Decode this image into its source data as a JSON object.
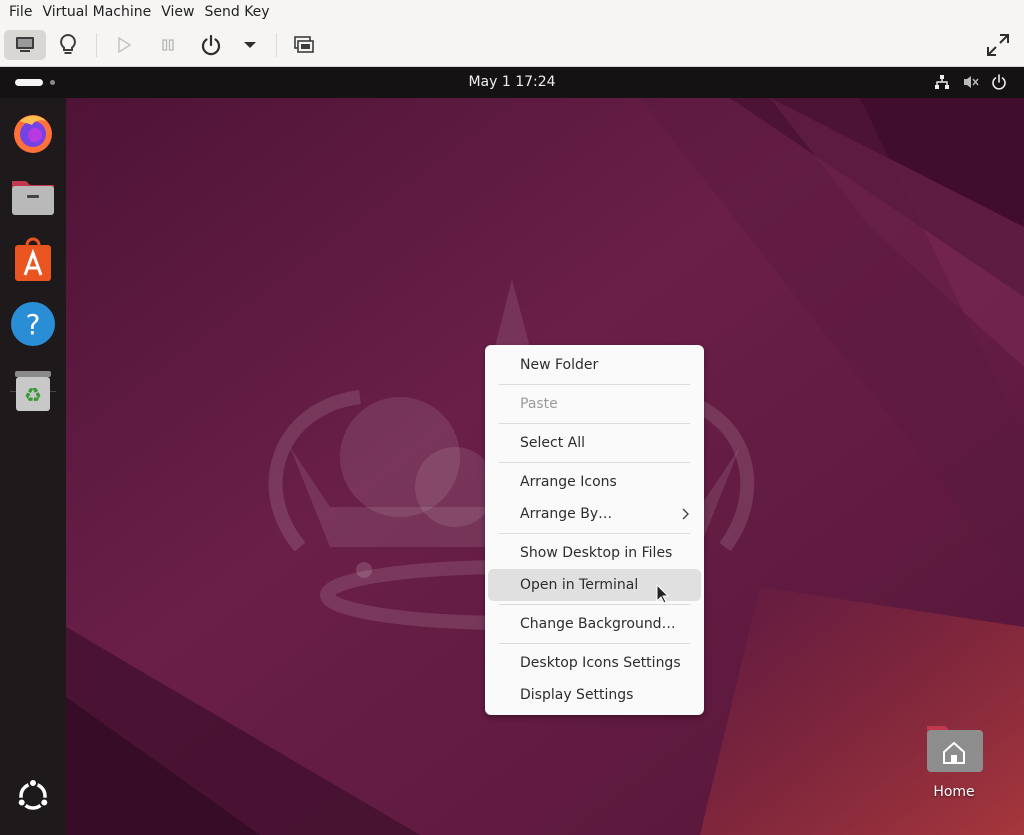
{
  "menubar": {
    "items": [
      "File",
      "Virtual Machine",
      "View",
      "Send Key"
    ]
  },
  "toolbar": {
    "buttons": [
      "display-icon",
      "lightbulb-icon",
      "play-icon",
      "pause-icon",
      "power-icon",
      "chevron-down-icon",
      "screenshot-icon",
      "fullscreen-icon"
    ]
  },
  "guest": {
    "topbar": {
      "clock": "May 1  17:24"
    },
    "dock": [
      "Firefox",
      "Files",
      "App Center",
      "Help",
      "Trash",
      "Show Apps"
    ],
    "context_menu": {
      "items": [
        {
          "label": "New Folder"
        },
        {
          "label": "Paste",
          "disabled": true
        },
        {
          "label": "Select All"
        },
        {
          "label": "Arrange Icons"
        },
        {
          "label": "Arrange By…",
          "submenu": true
        },
        {
          "label": "Show Desktop in Files"
        },
        {
          "label": "Open in Terminal",
          "highlighted": true
        },
        {
          "label": "Change Background…"
        },
        {
          "label": "Desktop Icons Settings"
        },
        {
          "label": "Display Settings"
        }
      ]
    },
    "desktop_icons": [
      {
        "label": "Home"
      }
    ]
  },
  "colors": {
    "wallpaper_dark": "#3a0f2a",
    "wallpaper_mid": "#6b1e48",
    "panel": "#141213",
    "dock": "#1e1a1c",
    "menu_bg": "#fafafa",
    "menu_hover": "#e0e0e0"
  }
}
